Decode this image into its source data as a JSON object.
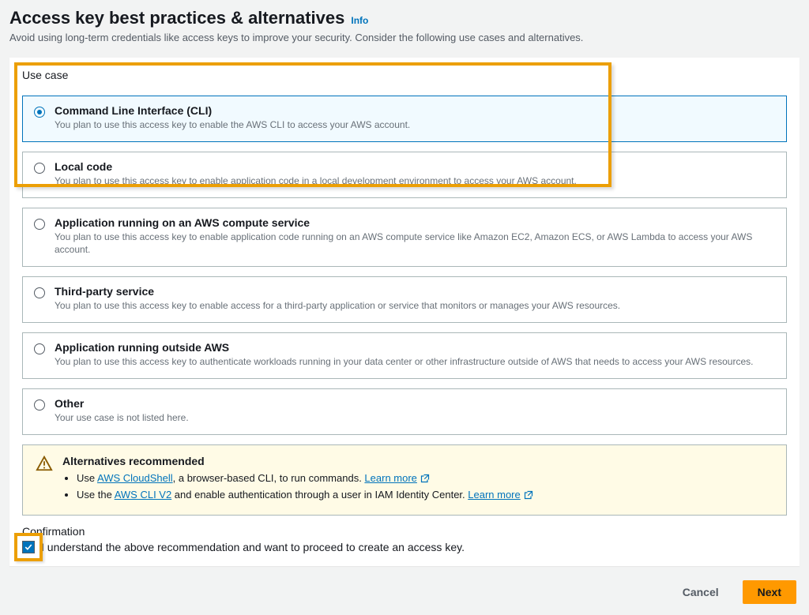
{
  "header": {
    "title": "Access key best practices & alternatives",
    "info_label": "Info",
    "subtitle": "Avoid using long-term credentials like access keys to improve your security. Consider the following use cases and alternatives."
  },
  "usecase": {
    "label": "Use case",
    "options": [
      {
        "title": "Command Line Interface (CLI)",
        "desc": "You plan to use this access key to enable the AWS CLI to access your AWS account.",
        "selected": true
      },
      {
        "title": "Local code",
        "desc": "You plan to use this access key to enable application code in a local development environment to access your AWS account.",
        "selected": false
      },
      {
        "title": "Application running on an AWS compute service",
        "desc": "You plan to use this access key to enable application code running on an AWS compute service like Amazon EC2, Amazon ECS, or AWS Lambda to access your AWS account.",
        "selected": false
      },
      {
        "title": "Third-party service",
        "desc": "You plan to use this access key to enable access for a third-party application or service that monitors or manages your AWS resources.",
        "selected": false
      },
      {
        "title": "Application running outside AWS",
        "desc": "You plan to use this access key to authenticate workloads running in your data center or other infrastructure outside of AWS that needs to access your AWS resources.",
        "selected": false
      },
      {
        "title": "Other",
        "desc": "Your use case is not listed here.",
        "selected": false
      }
    ]
  },
  "alternatives": {
    "heading": "Alternatives recommended",
    "item1_pre": "Use ",
    "item1_link": "AWS CloudShell",
    "item1_post": ", a browser-based CLI, to run commands. ",
    "item2_pre": "Use the ",
    "item2_link": "AWS CLI V2",
    "item2_post": " and enable authentication through a user in IAM Identity Center. ",
    "learn_more": "Learn more"
  },
  "confirmation": {
    "label": "Confirmation",
    "checkbox_label": "I understand the above recommendation and want to proceed to create an access key.",
    "checked": true
  },
  "buttons": {
    "cancel": "Cancel",
    "next": "Next"
  }
}
